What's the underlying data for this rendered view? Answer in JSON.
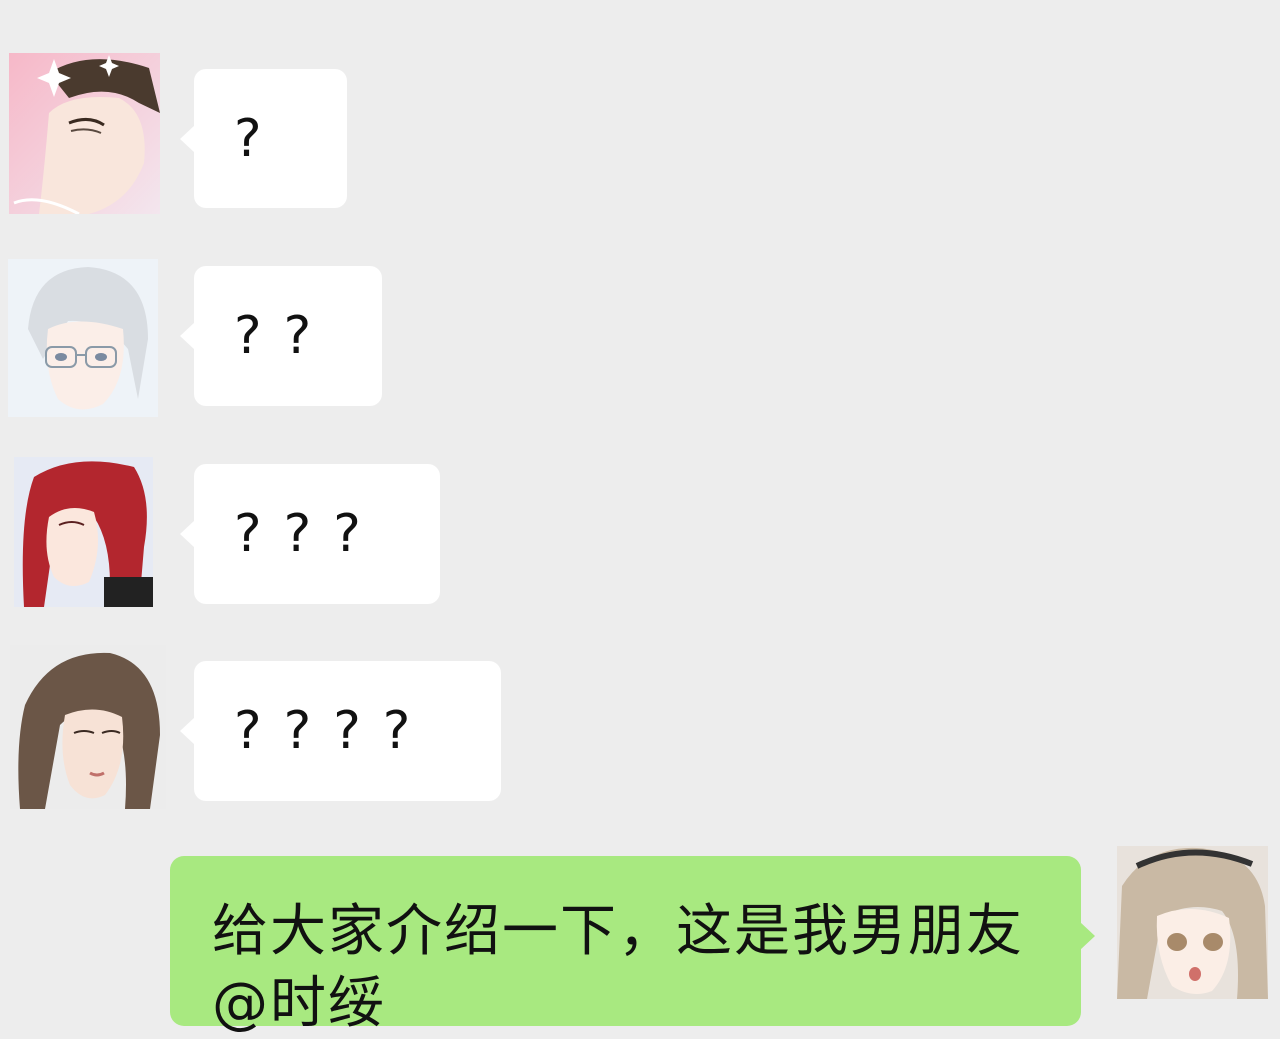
{
  "chat": {
    "messages": [
      {
        "sender": "avatar-1",
        "direction": "incoming",
        "text": "?"
      },
      {
        "sender": "avatar-2",
        "direction": "incoming",
        "text": "??"
      },
      {
        "sender": "avatar-3",
        "direction": "incoming",
        "text": "???"
      },
      {
        "sender": "avatar-4",
        "direction": "incoming",
        "text": "????"
      },
      {
        "sender": "avatar-self",
        "direction": "outgoing",
        "text": "给大家介绍一下，这是我男朋友@时绥"
      }
    ]
  },
  "colors": {
    "background": "#ededed",
    "incoming_bubble": "#ffffff",
    "outgoing_bubble": "#a8e980"
  },
  "icons": {
    "avatars": [
      "dark-hair-man-avatar-icon",
      "silver-hair-glasses-avatar-icon",
      "red-hair-avatar-icon",
      "brown-hair-avatar-icon",
      "blonde-girl-avatar-icon"
    ]
  }
}
